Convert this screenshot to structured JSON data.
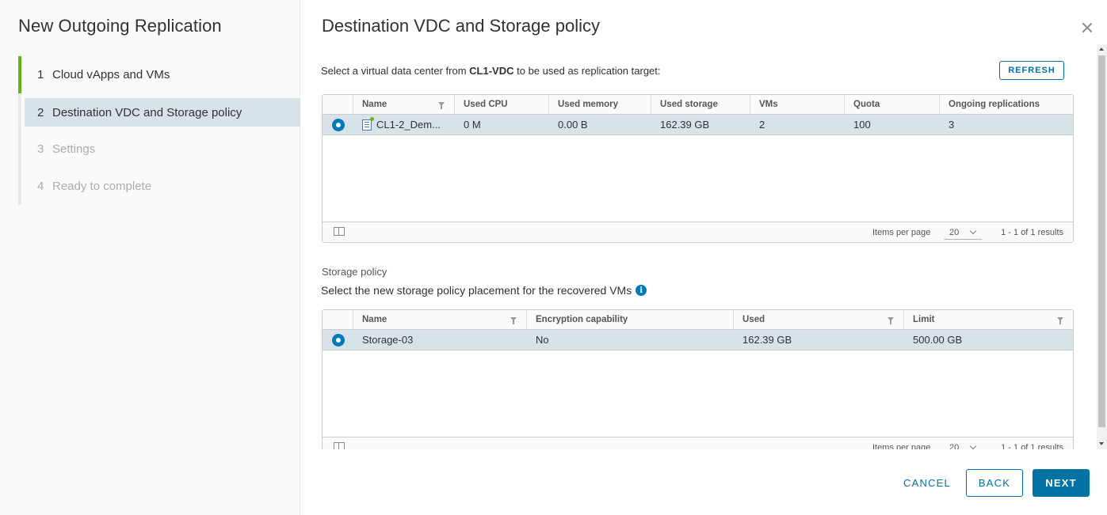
{
  "wizard": {
    "title": "New Outgoing Replication",
    "steps": [
      {
        "num": "1",
        "label": "Cloud vApps and VMs",
        "state": "done"
      },
      {
        "num": "2",
        "label": "Destination VDC and Storage policy",
        "state": "active"
      },
      {
        "num": "3",
        "label": "Settings",
        "state": "disabled"
      },
      {
        "num": "4",
        "label": "Ready to complete",
        "state": "disabled"
      }
    ]
  },
  "page": {
    "title": "Destination VDC and Storage policy",
    "intro_prefix": "Select a virtual data center from ",
    "intro_bold": "CL1-VDC",
    "intro_suffix": " to be used as replication target:",
    "refresh_label": "REFRESH"
  },
  "vdc_grid": {
    "columns": [
      "Name",
      "Used CPU",
      "Used memory",
      "Used storage",
      "VMs",
      "Quota",
      "Ongoing replications"
    ],
    "rows": [
      {
        "name": "CL1-2_Dem...",
        "used_cpu": "0 M",
        "used_memory": "0.00 B",
        "used_storage": "162.39 GB",
        "vms": "2",
        "quota": "100",
        "ongoing": "3",
        "selected": true
      }
    ],
    "footer": {
      "items_per_page_label": "Items per page",
      "items_per_page": "20",
      "results": "1 - 1 of 1 results"
    }
  },
  "storage": {
    "section_label": "Storage policy",
    "description": "Select the new storage policy placement for the recovered VMs",
    "info_icon": "i"
  },
  "storage_grid": {
    "columns": [
      "Name",
      "Encryption capability",
      "Used",
      "Limit"
    ],
    "rows": [
      {
        "name": "Storage-03",
        "encryption": "No",
        "used": "162.39 GB",
        "limit": "500.00 GB",
        "selected": true
      }
    ],
    "footer": {
      "items_per_page_label": "Items per page",
      "items_per_page": "20",
      "results": "1 - 1 of 1 results"
    }
  },
  "buttons": {
    "cancel": "CANCEL",
    "back": "BACK",
    "next": "NEXT"
  },
  "colors": {
    "accent": "#0072a3",
    "selected_row": "#d8e3e9",
    "step_done": "#60b515"
  }
}
